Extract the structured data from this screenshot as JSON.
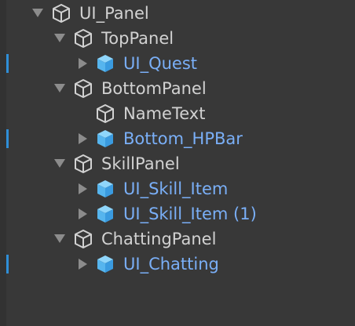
{
  "hierarchy": {
    "root": {
      "label": "UI_Panel",
      "expanded": true,
      "type": "gameobject",
      "icon": "cube-outline-icon"
    },
    "top_panel": {
      "label": "TopPanel",
      "expanded": true,
      "type": "gameobject",
      "icon": "cube-outline-icon"
    },
    "ui_quest": {
      "label": "UI_Quest",
      "expanded": false,
      "type": "prefab",
      "icon": "prefab-cube-icon",
      "modified": true
    },
    "bottom_panel": {
      "label": "BottomPanel",
      "expanded": true,
      "type": "gameobject",
      "icon": "cube-outline-icon"
    },
    "name_text": {
      "label": "NameText",
      "type": "gameobject",
      "icon": "cube-outline-icon"
    },
    "bottom_hpbar": {
      "label": "Bottom_HPBar",
      "expanded": false,
      "type": "prefab",
      "icon": "prefab-cube-icon",
      "modified": true
    },
    "skill_panel": {
      "label": "SkillPanel",
      "expanded": true,
      "type": "gameobject",
      "icon": "cube-outline-icon"
    },
    "ui_skill_item": {
      "label": "UI_Skill_Item",
      "expanded": false,
      "type": "prefab",
      "icon": "prefab-cube-icon"
    },
    "ui_skill_item_1": {
      "label": "UI_Skill_Item (1)",
      "expanded": false,
      "type": "prefab",
      "icon": "prefab-cube-icon"
    },
    "chatting_panel": {
      "label": "ChattingPanel",
      "expanded": true,
      "type": "gameobject",
      "icon": "cube-outline-icon"
    },
    "ui_chatting": {
      "label": "UI_Chatting",
      "expanded": false,
      "type": "prefab",
      "icon": "prefab-cube-icon",
      "modified": true
    }
  },
  "colors": {
    "background": "#383838",
    "plain_text": "#d2d2d2",
    "prefab_text": "#7aaff7",
    "prefab_icon": "#6cc3f5",
    "modified_marker": "#2f8fd8",
    "arrow": "#8c8c8c"
  }
}
